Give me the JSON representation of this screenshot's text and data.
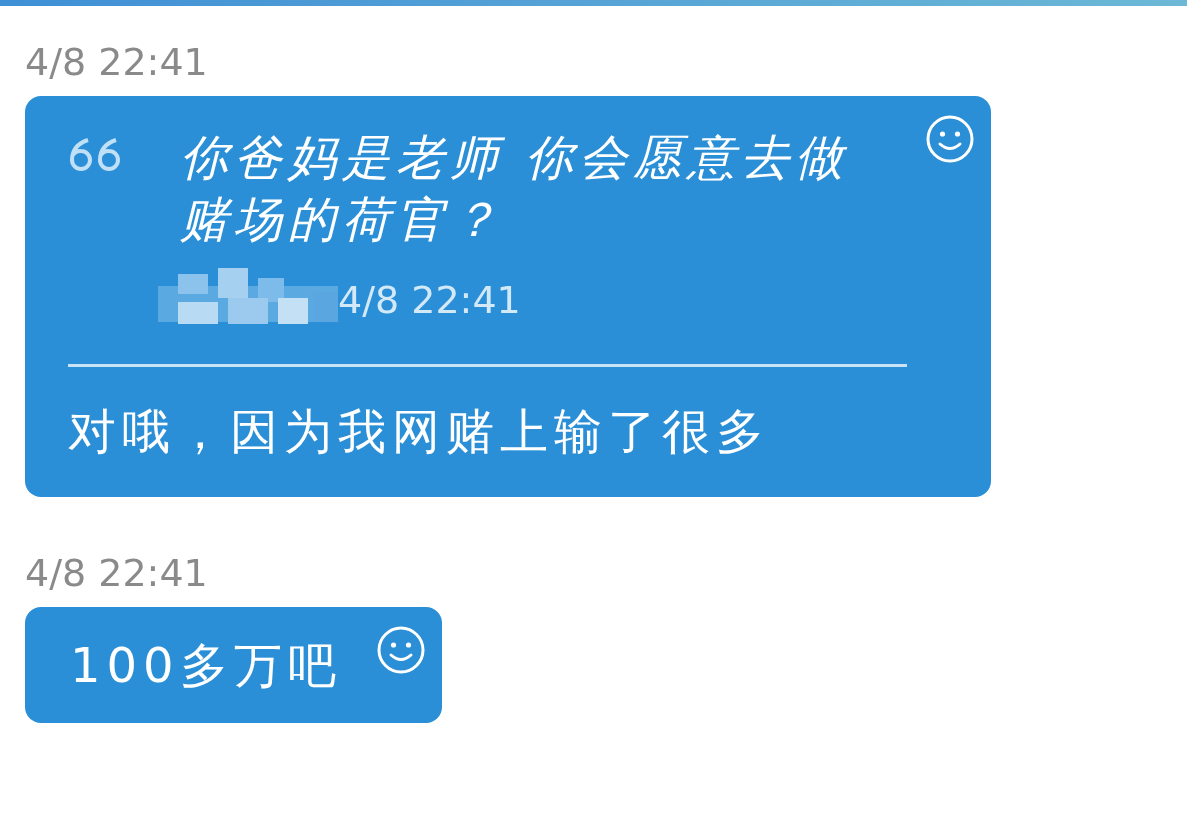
{
  "messages": [
    {
      "time": "4/8 22:41",
      "quote": {
        "text": "你爸妈是老师  你会愿意去做赌场的荷官？",
        "time": "4/8 22:41",
        "redacted": true
      },
      "text": "对哦，因为我网赌上输了很多"
    },
    {
      "time": "4/8 22:41",
      "text": "100多万吧"
    }
  ]
}
